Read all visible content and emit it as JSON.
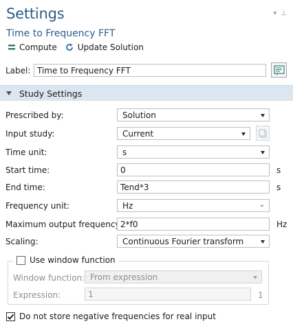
{
  "header": {
    "title": "Settings",
    "subtitle": "Time to Frequency FFT",
    "compute_label": "Compute",
    "update_label": "Update Solution"
  },
  "label_row": {
    "label": "Label:",
    "value": "Time to Frequency FFT"
  },
  "section": {
    "title": "Study Settings"
  },
  "fields": {
    "prescribed_by": {
      "label": "Prescribed by:",
      "value": "Solution"
    },
    "input_study": {
      "label": "Input study:",
      "value": "Current"
    },
    "time_unit": {
      "label": "Time unit:",
      "value": "s"
    },
    "start_time": {
      "label": "Start time:",
      "value": "0",
      "unit": "s"
    },
    "end_time": {
      "label": "End time:",
      "value": "Tend*3",
      "unit": "s"
    },
    "frequency_unit": {
      "label": "Frequency unit:",
      "value": "Hz"
    },
    "max_output_freq": {
      "label": "Maximum output frequency:",
      "value": "2*f0",
      "unit": "Hz"
    },
    "scaling": {
      "label": "Scaling:",
      "value": "Continuous Fourier transform"
    }
  },
  "window": {
    "checkbox_label": "Use window function",
    "checked": false,
    "function_label": "Window function:",
    "function_value": "From expression",
    "expression_label": "Expression:",
    "expression_value": "1",
    "expression_unit": "1"
  },
  "negative_freq": {
    "label": "Do not store negative frequencies for real input",
    "checked": true
  },
  "colors": {
    "title": "#2c5d8a",
    "section_bg": "#dce6f0",
    "compute_icon": "#2a7a6a",
    "update_icon": "#2a6fa5"
  },
  "icons": {
    "compute": "equals-icon",
    "update": "refresh-icon",
    "label_button": "document-edit-icon",
    "input_study_button": "copy-icon"
  }
}
